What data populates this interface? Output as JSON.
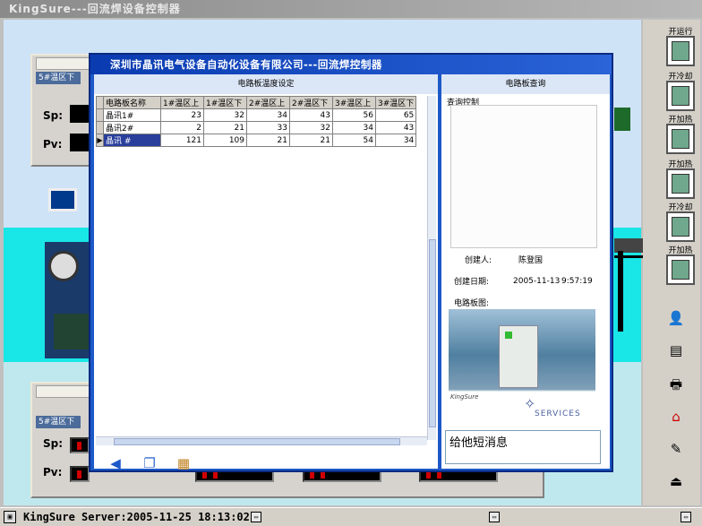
{
  "app": {
    "title": "KingSure---回流焊设备控制器"
  },
  "background_panels": {
    "zone_label": "5#温区下",
    "sp_label": "Sp:",
    "pv_label": "Pv:"
  },
  "right_toolbar": {
    "buttons": [
      "开运行",
      "开冷却",
      "开加热",
      "开加热",
      "开冷却",
      "开加热"
    ]
  },
  "dialog": {
    "title": "深圳市晶讯电气设备自动化设备有限公司---回流焊控制器",
    "left_header": "电路板温度设定",
    "right_header": "电路板查询",
    "table": {
      "columns": [
        "电路板名称",
        "1#温区上",
        "1#温区下",
        "2#温区上",
        "2#温区下",
        "3#温区上",
        "3#温区下"
      ],
      "rows": [
        {
          "name": "晶讯1#",
          "values": [
            "23",
            "32",
            "34",
            "43",
            "56",
            "65"
          ]
        },
        {
          "name": "晶讯2#",
          "values": [
            "2",
            "21",
            "33",
            "32",
            "34",
            "43"
          ]
        },
        {
          "name": "晶讯 #",
          "values": [
            "121",
            "109",
            "21",
            "21",
            "54",
            "34"
          ]
        }
      ]
    },
    "query_label": "查询控制",
    "creator_label": "创建人:",
    "creator_value": "陈登国",
    "date_label": "创建日期:",
    "date_value": "2005-11-13",
    "time_value": "9:57:19",
    "photo_label": "电路板图:",
    "photo_brand": "KingSure",
    "photo_services": "SERVICES",
    "message": "给他短消息"
  },
  "status_bar": {
    "text": "KingSure Server:2005-11-25 18:13:02"
  }
}
